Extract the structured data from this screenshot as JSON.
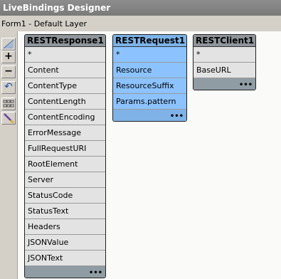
{
  "window": {
    "title": "LiveBindings Designer"
  },
  "layer": {
    "form": "Form1",
    "separator": " - ",
    "name": "Default Layer"
  },
  "toolbar": {
    "tools": [
      {
        "name": "grid-toggle-icon"
      },
      {
        "name": "zoom-in-icon",
        "glyph": "+"
      },
      {
        "name": "zoom-out-icon",
        "glyph": "−"
      },
      {
        "name": "undo-icon",
        "glyph": "↶"
      },
      {
        "name": "layers-icon"
      },
      {
        "name": "link-wizard-icon"
      }
    ]
  },
  "components": [
    {
      "title": "RESTResponse1",
      "style": "gray",
      "fields": [
        "*",
        "Content",
        "ContentType",
        "ContentLength",
        "ContentEncoding",
        "ErrorMessage",
        "FullRequestURI",
        "RootElement",
        "Server",
        "StatusCode",
        "StatusText",
        "Headers",
        "JSONValue",
        "JSONText"
      ],
      "more": "•••"
    },
    {
      "title": "RESTRequest1",
      "style": "blue",
      "fields": [
        "*",
        "Resource",
        "ResourceSuffix",
        "Params.pattern"
      ],
      "more": "•••"
    },
    {
      "title": "RESTClient1",
      "style": "gray",
      "fields": [
        "*",
        "BaseURL"
      ],
      "more": "•••"
    }
  ]
}
